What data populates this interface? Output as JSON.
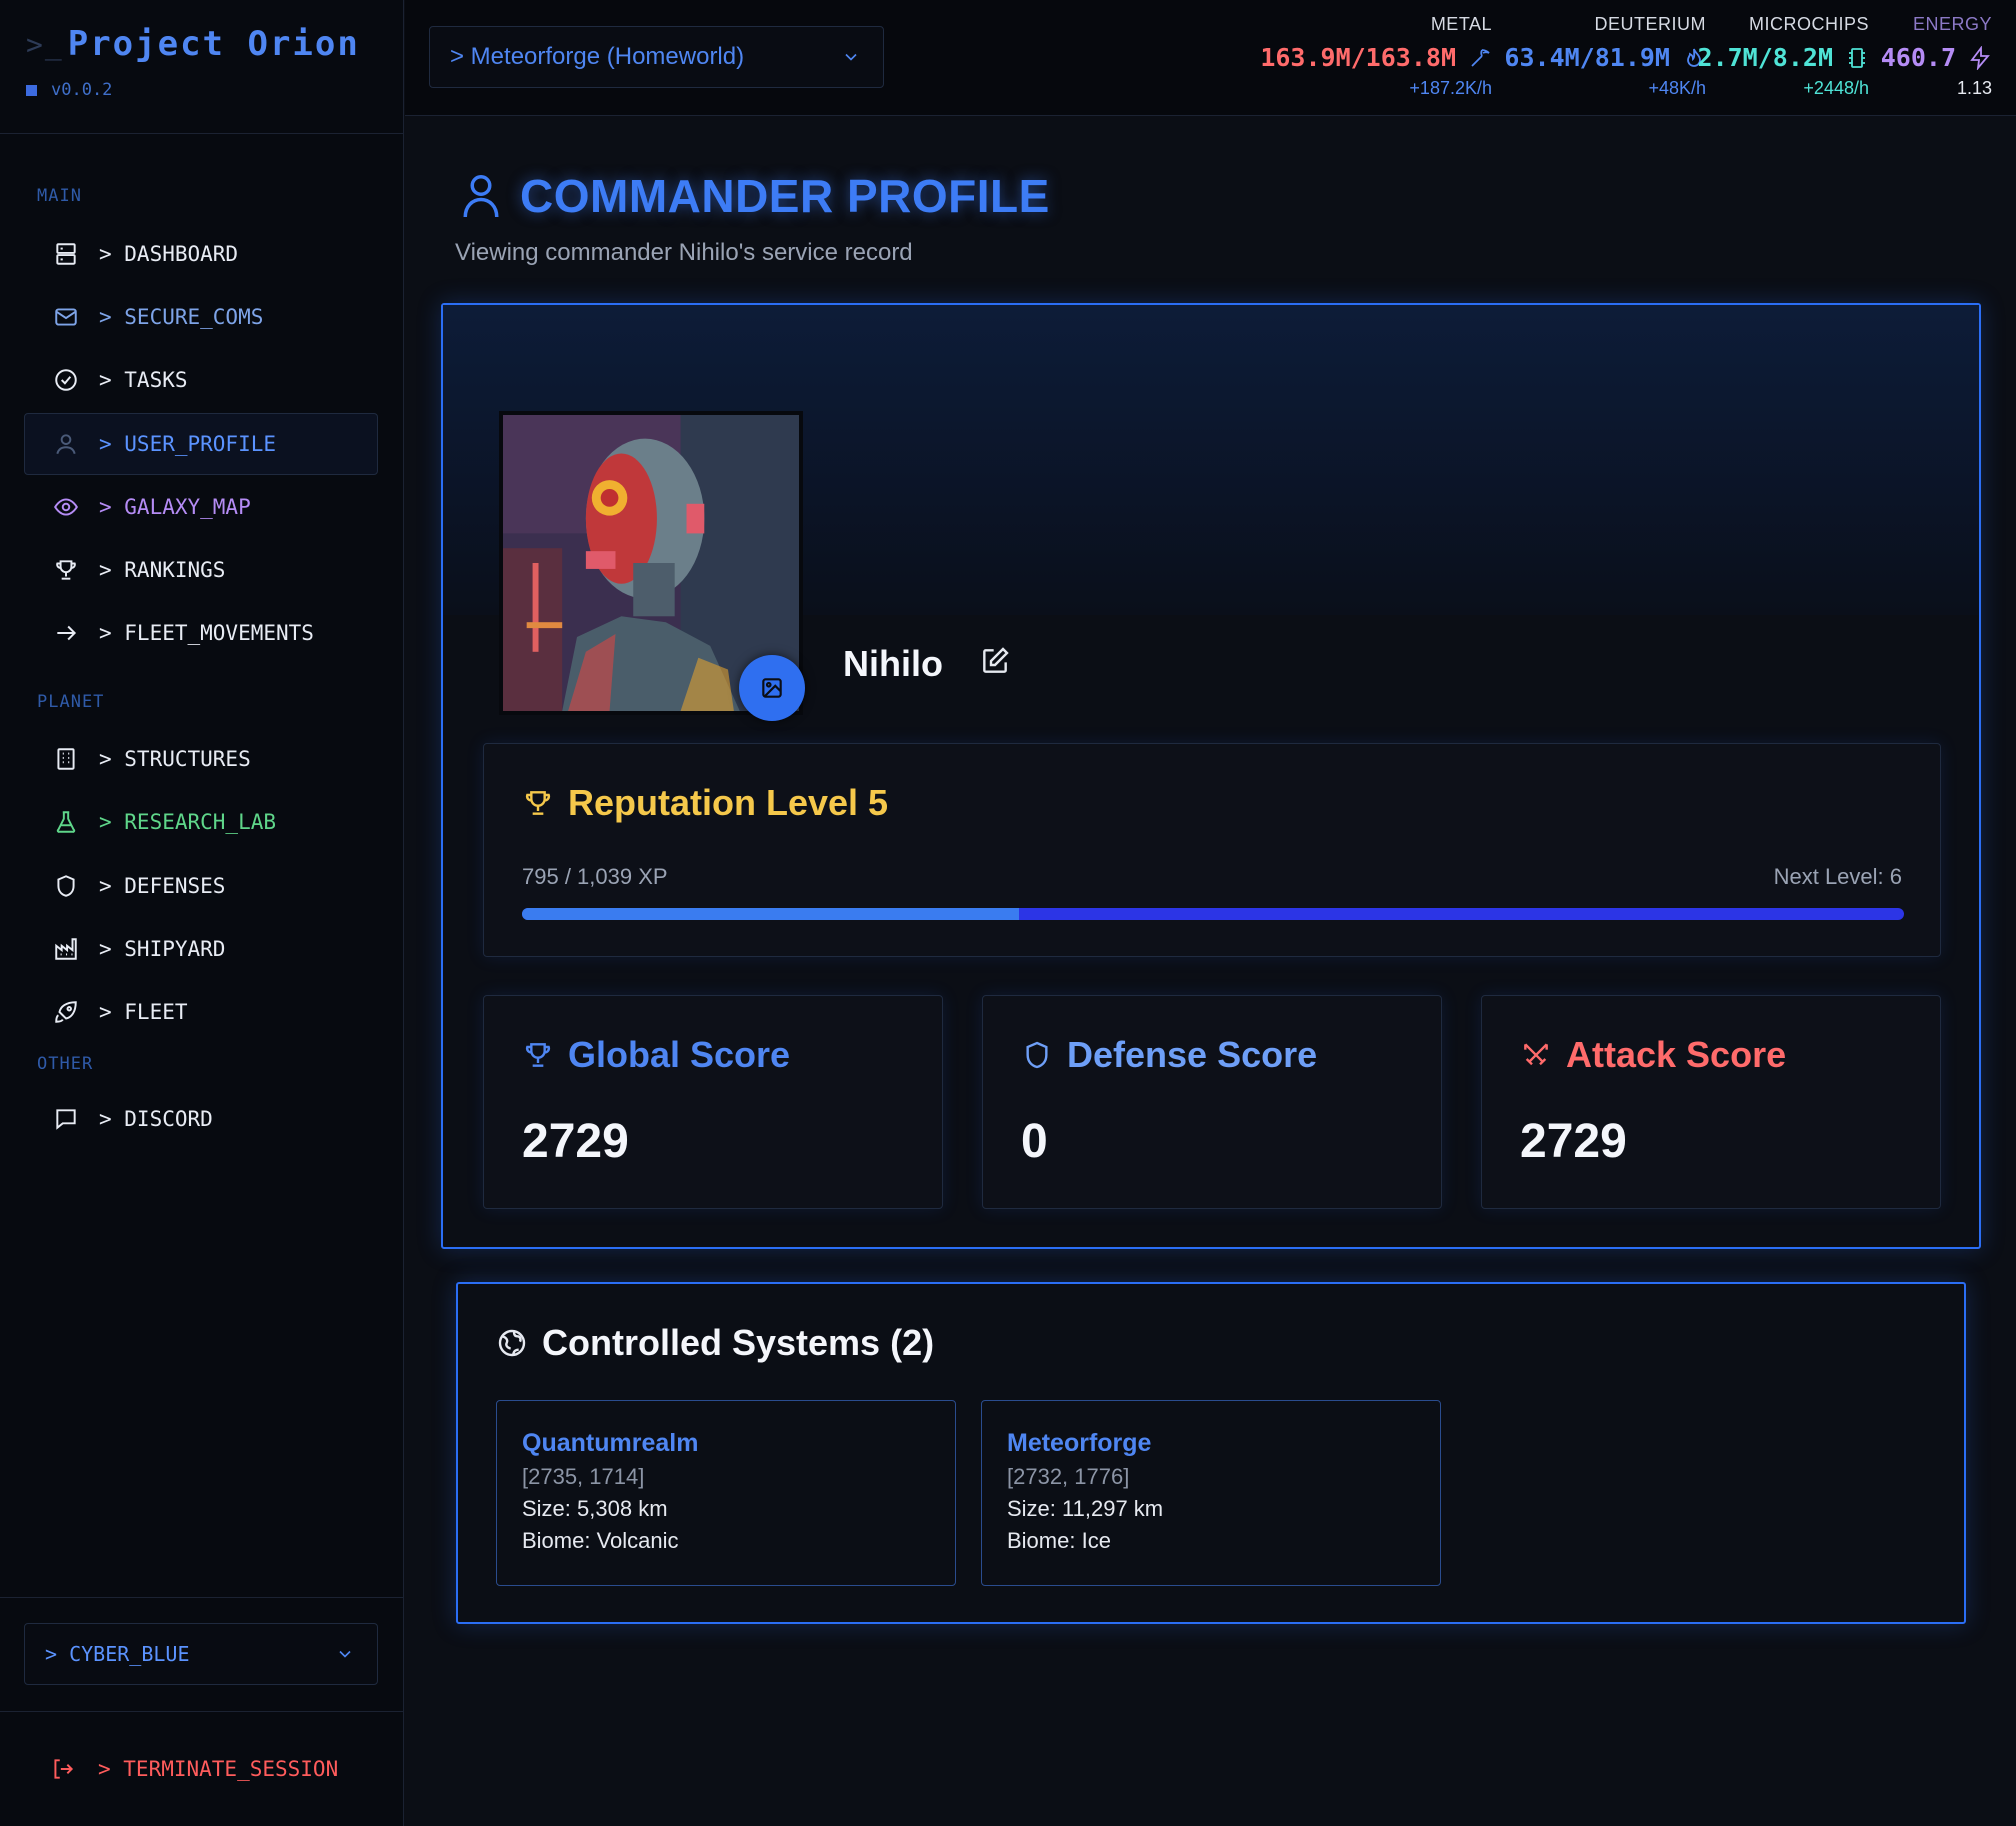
{
  "brand": {
    "title": "Project Orion",
    "version": "v0.0.2"
  },
  "sidebar": {
    "sections": {
      "main": "MAIN",
      "planet": "PLANET",
      "other": "OTHER"
    },
    "items": [
      {
        "label": "> DASHBOARD",
        "icon": "server-icon",
        "color": "#e8ecf4"
      },
      {
        "label": "> SECURE_COMS",
        "icon": "mail-icon",
        "color": "#7ea4e8"
      },
      {
        "label": "> TASKS",
        "icon": "check-circle-icon",
        "color": "#e8ecf4"
      },
      {
        "label": "> USER_PROFILE",
        "icon": "user-icon",
        "color": "#5b93ff"
      },
      {
        "label": "> GALAXY_MAP",
        "icon": "eye-icon",
        "color": "#b58cf5"
      },
      {
        "label": "> RANKINGS",
        "icon": "trophy-icon",
        "color": "#e8ecf4"
      },
      {
        "label": "> FLEET_MOVEMENTS",
        "icon": "arrow-right-icon",
        "color": "#e8ecf4"
      },
      {
        "label": "> STRUCTURES",
        "icon": "building-icon",
        "color": "#e8ecf4"
      },
      {
        "label": "> RESEARCH_LAB",
        "icon": "flask-icon",
        "color": "#5fd68a"
      },
      {
        "label": "> DEFENSES",
        "icon": "shield-icon",
        "color": "#e8ecf4"
      },
      {
        "label": "> SHIPYARD",
        "icon": "factory-icon",
        "color": "#e8ecf4"
      },
      {
        "label": "> FLEET",
        "icon": "rocket-icon",
        "color": "#e8ecf4"
      },
      {
        "label": "> DISCORD",
        "icon": "message-icon",
        "color": "#e8ecf4"
      }
    ],
    "theme_select": "> CYBER_BLUE",
    "terminate": "> TERMINATE_SESSION"
  },
  "topbar": {
    "planet_select": "> Meteorforge (Homeworld)",
    "resources": [
      {
        "label": "METAL",
        "value": "163.9M/163.8M",
        "rate": "+187.2K/h",
        "color": "#ff6b6b",
        "rate_color": "#4f86f2",
        "icon": "pickaxe-icon"
      },
      {
        "label": "DEUTERIUM",
        "value": "63.4M/81.9M",
        "rate": "+48K/h",
        "color": "#4f86f2",
        "rate_color": "#4f86f2",
        "icon": "flame-icon"
      },
      {
        "label": "MICROCHIPS",
        "value": "2.7M/8.2M",
        "rate": "+2448/h",
        "color": "#4fe3d6",
        "rate_color": "#4fe3d6",
        "icon": "chip-icon"
      },
      {
        "label": "ENERGY",
        "value": "460.7",
        "rate": "1.13",
        "color": "#b58cf5",
        "rate_color": "#e6e9f0",
        "icon": "bolt-icon"
      }
    ]
  },
  "page": {
    "title": "COMMANDER PROFILE",
    "subtitle": "Viewing commander Nihilo's service record"
  },
  "profile": {
    "name": "Nihilo",
    "reputation": {
      "title": "Reputation Level 5",
      "xp_text": "795 / 1,039 XP",
      "next_level": "Next Level: 6",
      "xp_current": 795,
      "xp_max": 1039
    },
    "scores": [
      {
        "title": "Global Score",
        "value": "2729",
        "color": "#4f86f2",
        "icon": "trophy-icon"
      },
      {
        "title": "Defense Score",
        "value": "0",
        "color": "#6e9ff7",
        "icon": "shield-icon"
      },
      {
        "title": "Attack Score",
        "value": "2729",
        "color": "#ff6b6b",
        "icon": "swords-icon"
      }
    ]
  },
  "systems": {
    "title": "Controlled Systems (2)",
    "items": [
      {
        "name": "Quantumrealm",
        "coords": "[2735, 1714]",
        "size": "Size: 5,308 km",
        "biome": "Biome: Volcanic"
      },
      {
        "name": "Meteorforge",
        "coords": "[2732, 1776]",
        "size": "Size: 11,297 km",
        "biome": "Biome: Ice"
      }
    ]
  }
}
